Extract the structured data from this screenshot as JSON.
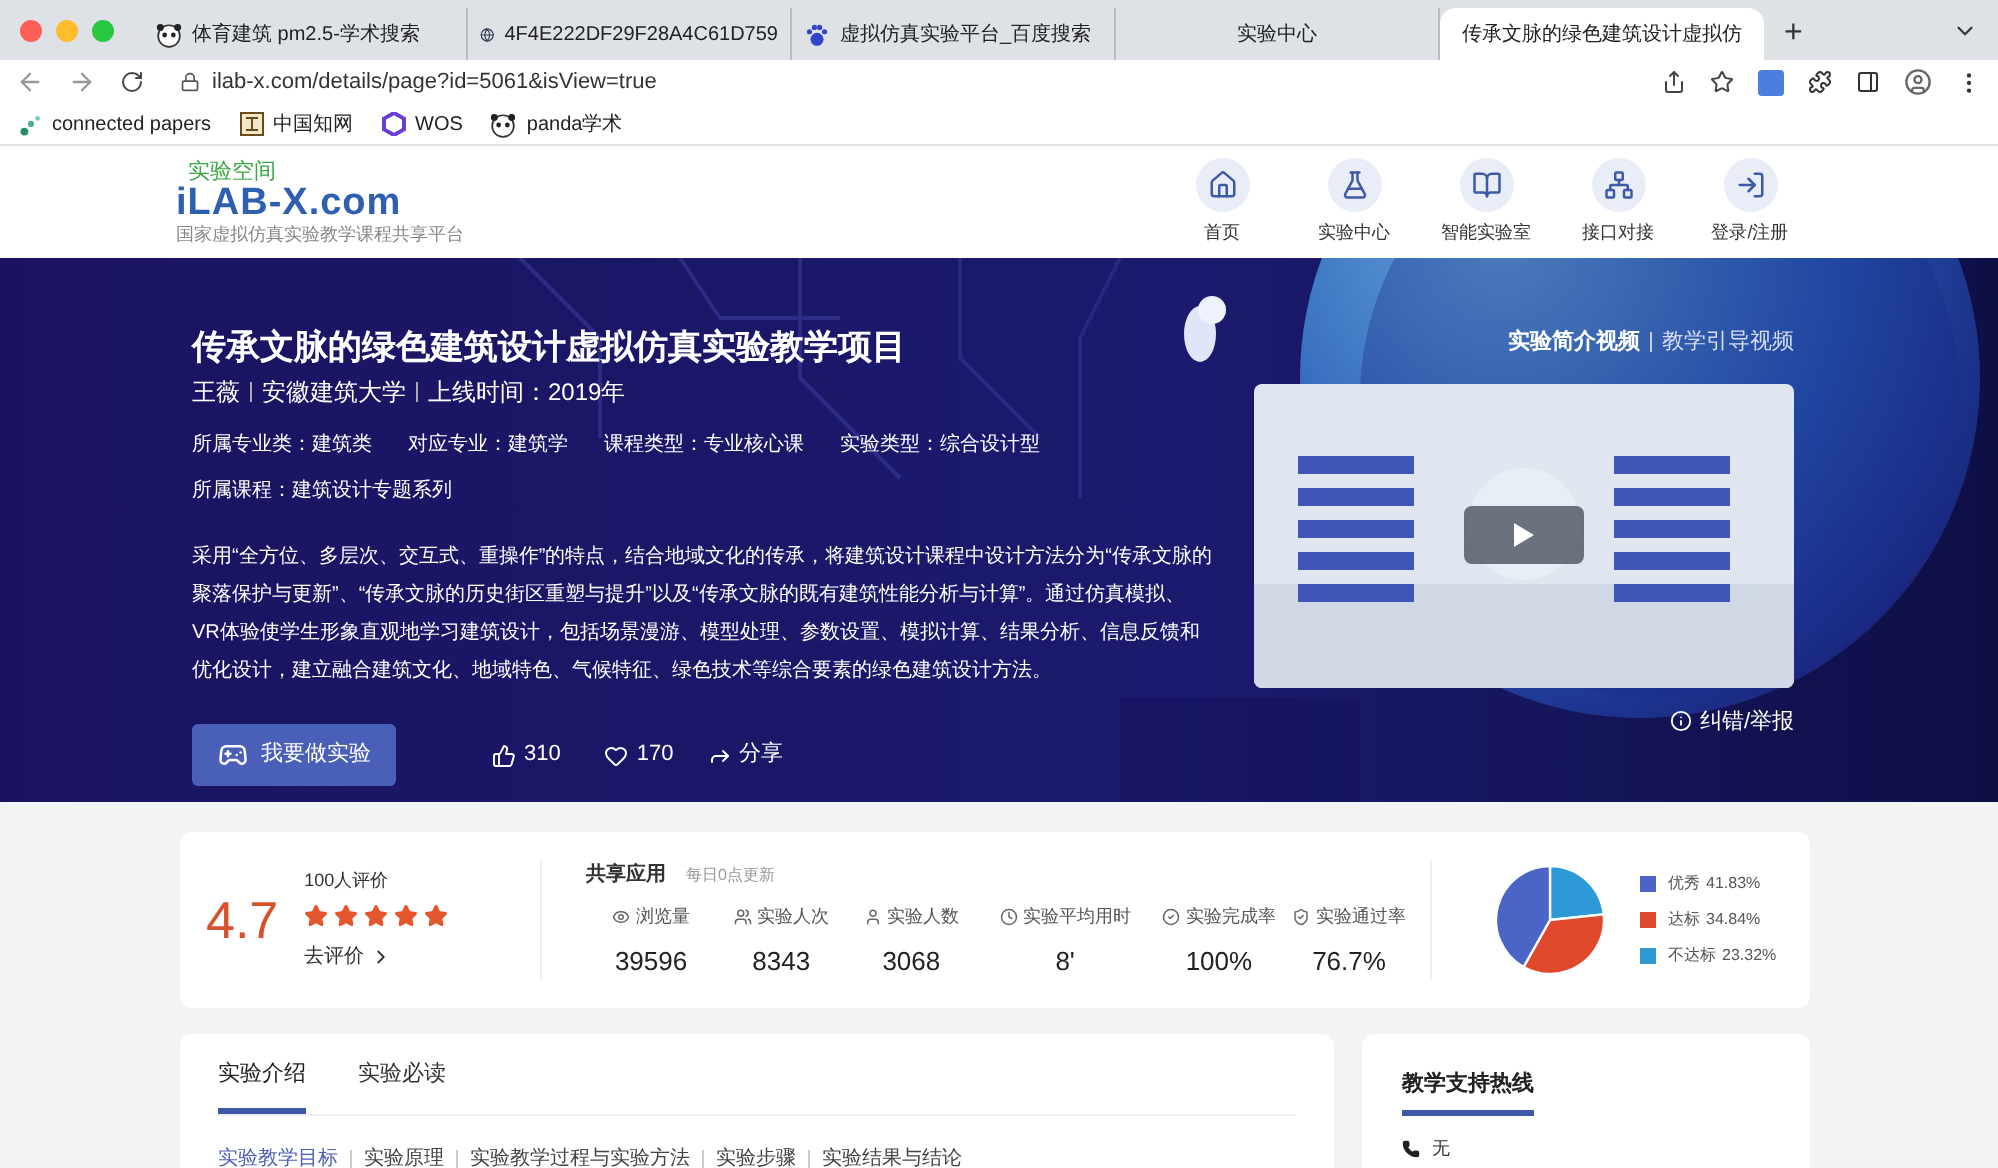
{
  "browser": {
    "tabs": [
      {
        "title": "体育建筑 pm2.5-学术搜索",
        "kind": "panda",
        "selected": false
      },
      {
        "title": "4F4E222DF29F28A4C61D759",
        "kind": "globe",
        "selected": false
      },
      {
        "title": "虚拟仿真实验平台_百度搜索",
        "kind": "paw",
        "selected": false
      },
      {
        "title": "实验中心",
        "kind": "plain",
        "selected": false
      },
      {
        "title": "传承文脉的绿色建筑设计虚拟仿",
        "kind": "plain",
        "selected": true
      }
    ],
    "new_tab": "+",
    "url": "ilab-x.com/details/page?id=5061&isView=true",
    "bookmarks": [
      {
        "label": "connected papers",
        "kind": "dots"
      },
      {
        "label": "中国知网",
        "kind": "cnki"
      },
      {
        "label": "WOS",
        "kind": "hex"
      },
      {
        "label": "panda学术",
        "kind": "panda"
      }
    ]
  },
  "site": {
    "logo_top": "实验空间",
    "logo_main": "iLAB-X.com",
    "logo_sub": "国家虚拟仿真实验教学课程共享平台",
    "nav": [
      "首页",
      "实验中心",
      "智能实验室",
      "接口对接",
      "登录/注册"
    ]
  },
  "banner": {
    "title": "传承文脉的绿色建筑设计虚拟仿真实验教学项目",
    "byline": [
      "王薇",
      "安徽建筑大学",
      "上线时间：2019年"
    ],
    "meta": [
      "所属专业类：建筑类",
      "对应专业：建筑学",
      "课程类型：专业核心课",
      "实验类型：综合设计型"
    ],
    "course": "所属课程：建筑设计专题系列",
    "description": "采用“全方位、多层次、交互式、重操作”的特点，结合地域文化的传承，将建筑设计课程中设计方法分为“传承文脉的聚落保护与更新”、“传承文脉的历史街区重塑与提升”以及“传承文脉的既有建筑性能分析与计算”。通过仿真模拟、VR体验使学生形象直观地学习建筑设计，包括场景漫游、模型处理、参数设置、模拟计算、结果分析、信息反馈和优化设计，建立融合建筑文化、地域特色、气候特征、绿色技术等综合要素的绿色建筑设计方法。",
    "start_button": "我要做实验",
    "likes": "310",
    "favorites": "170",
    "share": "分享",
    "video_tabs": [
      {
        "label": "实验简介视频",
        "selected": true
      },
      {
        "label": "教学引导视频",
        "selected": false
      }
    ],
    "report": "纠错/举报"
  },
  "stats": {
    "rating": "4.7",
    "reviews": "100人评价",
    "stars": 5,
    "review_link": "去评价",
    "heading": "共享应用",
    "note": "每日0点更新",
    "metrics": [
      {
        "label": "浏览量",
        "value": "39596"
      },
      {
        "label": "实验人次",
        "value": "8343"
      },
      {
        "label": "实验人数",
        "value": "3068"
      },
      {
        "label": "实验平均用时",
        "value": "8'"
      },
      {
        "label": "实验完成率",
        "value": "100%"
      },
      {
        "label": "实验通过率",
        "value": "76.7%"
      }
    ],
    "chart_data": {
      "type": "pie",
      "categories": [
        "优秀",
        "达标",
        "不达标"
      ],
      "values": [
        41.83,
        34.84,
        23.32
      ]
    },
    "legend": [
      {
        "value": "41.83%",
        "color": "#4a65c6"
      },
      {
        "value": "34.84%",
        "color": "#e0482b"
      },
      {
        "value": "23.32%",
        "color": "#2b9ad6"
      }
    ]
  },
  "intro": {
    "tabs": [
      {
        "label": "实验介绍",
        "selected": true
      },
      {
        "label": "实验必读",
        "selected": false
      }
    ],
    "sections": [
      {
        "label": "实验教学目标",
        "selected": true
      },
      {
        "label": "实验原理",
        "selected": false
      },
      {
        "label": "实验教学过程与实验方法",
        "selected": false
      },
      {
        "label": "实验步骤",
        "selected": false
      },
      {
        "label": "实验结果与结论",
        "selected": false
      }
    ]
  },
  "hotline": {
    "title": "教学支持热线",
    "phone": "无"
  }
}
